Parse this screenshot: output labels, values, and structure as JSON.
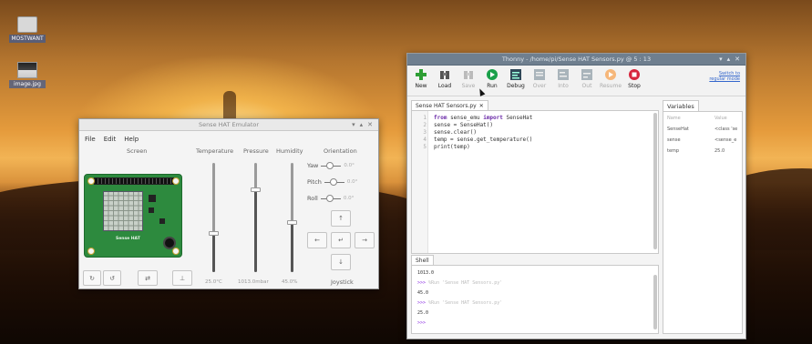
{
  "desktop": {
    "icons": [
      {
        "label": "MOSTWANT",
        "kind": "folder"
      },
      {
        "label": "image.jpg",
        "kind": "image"
      }
    ]
  },
  "sense_window": {
    "title": "Sense HAT Emulator",
    "menu": [
      "File",
      "Edit",
      "Help"
    ],
    "columns": {
      "screen": "Screen",
      "temperature": "Temperature",
      "pressure": "Pressure",
      "humidity": "Humidity",
      "orientation": "Orientation"
    },
    "sliders": {
      "temperature": {
        "value": "25.0°C",
        "level": 0.35
      },
      "pressure": {
        "value": "1013.0mbar",
        "level": 0.75
      },
      "humidity": {
        "value": "45.0%",
        "level": 0.45
      }
    },
    "orientation": [
      {
        "label": "Yaw",
        "value": "0.0°"
      },
      {
        "label": "Pitch",
        "value": "0.0°"
      },
      {
        "label": "Roll",
        "value": "0.0°"
      }
    ],
    "joystick": {
      "label": "Joystick",
      "up": "↑",
      "down": "↓",
      "left": "←",
      "right": "→",
      "center": "↵"
    },
    "bottom_buttons": [
      "↻",
      "↺",
      "⇄",
      "⊥"
    ],
    "board_text": "Sense HAT"
  },
  "thonny_window": {
    "title": "Thonny - /home/pi/Sense HAT Sensors.py @ 5 : 13",
    "toolbar": [
      {
        "label": "New",
        "icon": "new-icon",
        "enabled": true
      },
      {
        "label": "Load",
        "icon": "load-icon",
        "enabled": true
      },
      {
        "label": "Save",
        "icon": "save-icon",
        "enabled": false
      },
      {
        "label": "Run",
        "icon": "run-icon",
        "enabled": true
      },
      {
        "label": "Debug",
        "icon": "debug-icon",
        "enabled": true
      },
      {
        "label": "Over",
        "icon": "step-over-icon",
        "enabled": false
      },
      {
        "label": "Into",
        "icon": "step-into-icon",
        "enabled": false
      },
      {
        "label": "Out",
        "icon": "step-out-icon",
        "enabled": false
      },
      {
        "label": "Resume",
        "icon": "resume-icon",
        "enabled": false
      },
      {
        "label": "Stop",
        "icon": "stop-icon",
        "enabled": true
      }
    ],
    "switch_mode": [
      "Switch to",
      "regular mode"
    ],
    "editor_tab": "Sense HAT Sensors.py",
    "code": [
      {
        "n": "1",
        "kw": "from",
        "rest1": " sense_emu ",
        "kw2": "import",
        "rest2": " SenseHat"
      },
      {
        "n": "2",
        "kw": "",
        "rest1": "sense = SenseHat()",
        "kw2": "",
        "rest2": ""
      },
      {
        "n": "3",
        "kw": "",
        "rest1": "sense.clear()",
        "kw2": "",
        "rest2": ""
      },
      {
        "n": "4",
        "kw": "",
        "rest1": "temp = sense.get_temperature()",
        "kw2": "",
        "rest2": ""
      },
      {
        "n": "5",
        "kw": "",
        "rest1": "print(temp)",
        "kw2": "",
        "rest2": ""
      }
    ],
    "variables": {
      "tab": "Variables",
      "headers": {
        "name": "Name",
        "value": "Value"
      },
      "rows": [
        {
          "name": "SenseHat",
          "value": "<class 'se"
        },
        {
          "name": "sense",
          "value": "<sense_e"
        },
        {
          "name": "temp",
          "value": "25.0"
        }
      ]
    },
    "shell": {
      "tab": "Shell",
      "lines": [
        {
          "prompt": "",
          "text": "1013.0",
          "dim": false
        },
        {
          "prompt": ">>>",
          "text": " %Run 'Sense HAT Sensors.py'",
          "dim": true
        },
        {
          "prompt": "",
          "text": "45.0",
          "dim": false
        },
        {
          "prompt": ">>>",
          "text": " %Run 'Sense HAT Sensors.py'",
          "dim": true
        },
        {
          "prompt": "",
          "text": "25.0",
          "dim": false
        },
        {
          "prompt": ">>>",
          "text": "",
          "dim": false
        }
      ]
    }
  },
  "colors": {
    "run_green": "#1aa04a",
    "new_green": "#2e9e34",
    "stop_red": "#d7263d",
    "resume_orange": "#f08a24",
    "keyword": "#6b2ba8",
    "prompt": "#8a2be2"
  }
}
